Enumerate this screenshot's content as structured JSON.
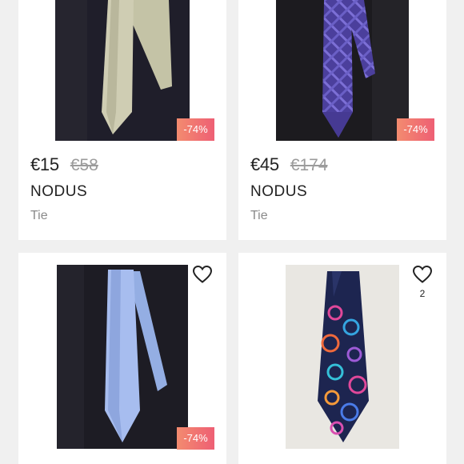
{
  "products": [
    {
      "price": "€15",
      "original_price": "€58",
      "brand": "NODUS",
      "category": "Tie",
      "discount": "-74%"
    },
    {
      "price": "€45",
      "original_price": "€174",
      "brand": "NODUS",
      "category": "Tie",
      "discount": "-74%"
    },
    {
      "discount": "-74%"
    },
    {
      "likes": "2"
    }
  ],
  "colors": {
    "badge_start": "#f38b6f",
    "badge_end": "#ee5f74",
    "background": "#f0f0f0",
    "card": "#ffffff"
  },
  "icons": {
    "like": "heart-outline-icon"
  }
}
